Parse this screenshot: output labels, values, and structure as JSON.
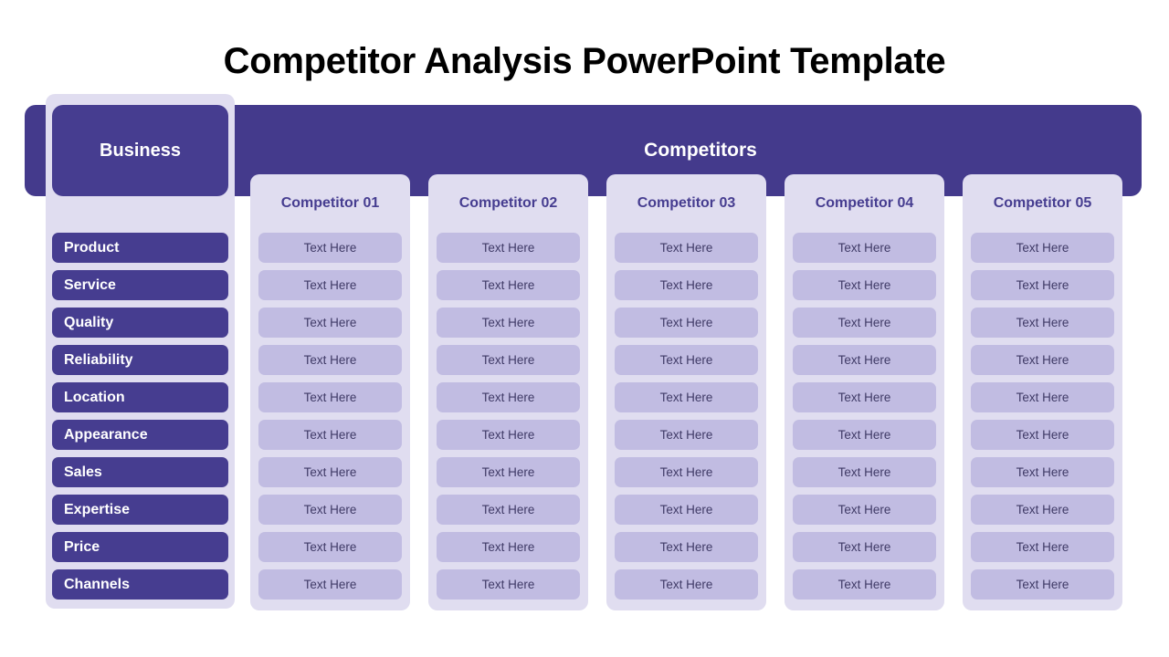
{
  "slide": {
    "title": "Competitor Analysis PowerPoint Template",
    "colors": {
      "dark_purple": "#443a8c",
      "panel_purple": "#463d90",
      "light_lavender": "#e0ddf0",
      "cell_lavender": "#c1bce2",
      "cell_text": "#3f3a66",
      "title_black": "#000000",
      "background": "#ffffff"
    }
  },
  "business": {
    "header_label": "Business",
    "criteria": [
      "Product",
      "Service",
      "Quality",
      "Reliability",
      "Location",
      "Appearance",
      "Sales",
      "Expertise",
      "Price",
      "Channels"
    ]
  },
  "competitors": {
    "banner_label": "Competitors",
    "cell_placeholder": "Text Here",
    "columns": [
      {
        "header": "Competitor 01",
        "cells": [
          "Text Here",
          "Text Here",
          "Text Here",
          "Text Here",
          "Text Here",
          "Text Here",
          "Text Here",
          "Text Here",
          "Text Here",
          "Text Here"
        ]
      },
      {
        "header": "Competitor 02",
        "cells": [
          "Text Here",
          "Text Here",
          "Text Here",
          "Text Here",
          "Text Here",
          "Text Here",
          "Text Here",
          "Text Here",
          "Text Here",
          "Text Here"
        ]
      },
      {
        "header": "Competitor 03",
        "cells": [
          "Text Here",
          "Text Here",
          "Text Here",
          "Text Here",
          "Text Here",
          "Text Here",
          "Text Here",
          "Text Here",
          "Text Here",
          "Text Here"
        ]
      },
      {
        "header": "Competitor 04",
        "cells": [
          "Text Here",
          "Text Here",
          "Text Here",
          "Text Here",
          "Text Here",
          "Text Here",
          "Text Here",
          "Text Here",
          "Text Here",
          "Text Here"
        ]
      },
      {
        "header": "Competitor 05",
        "cells": [
          "Text Here",
          "Text Here",
          "Text Here",
          "Text Here",
          "Text Here",
          "Text Here",
          "Text Here",
          "Text Here",
          "Text Here",
          "Text Here"
        ]
      }
    ]
  }
}
